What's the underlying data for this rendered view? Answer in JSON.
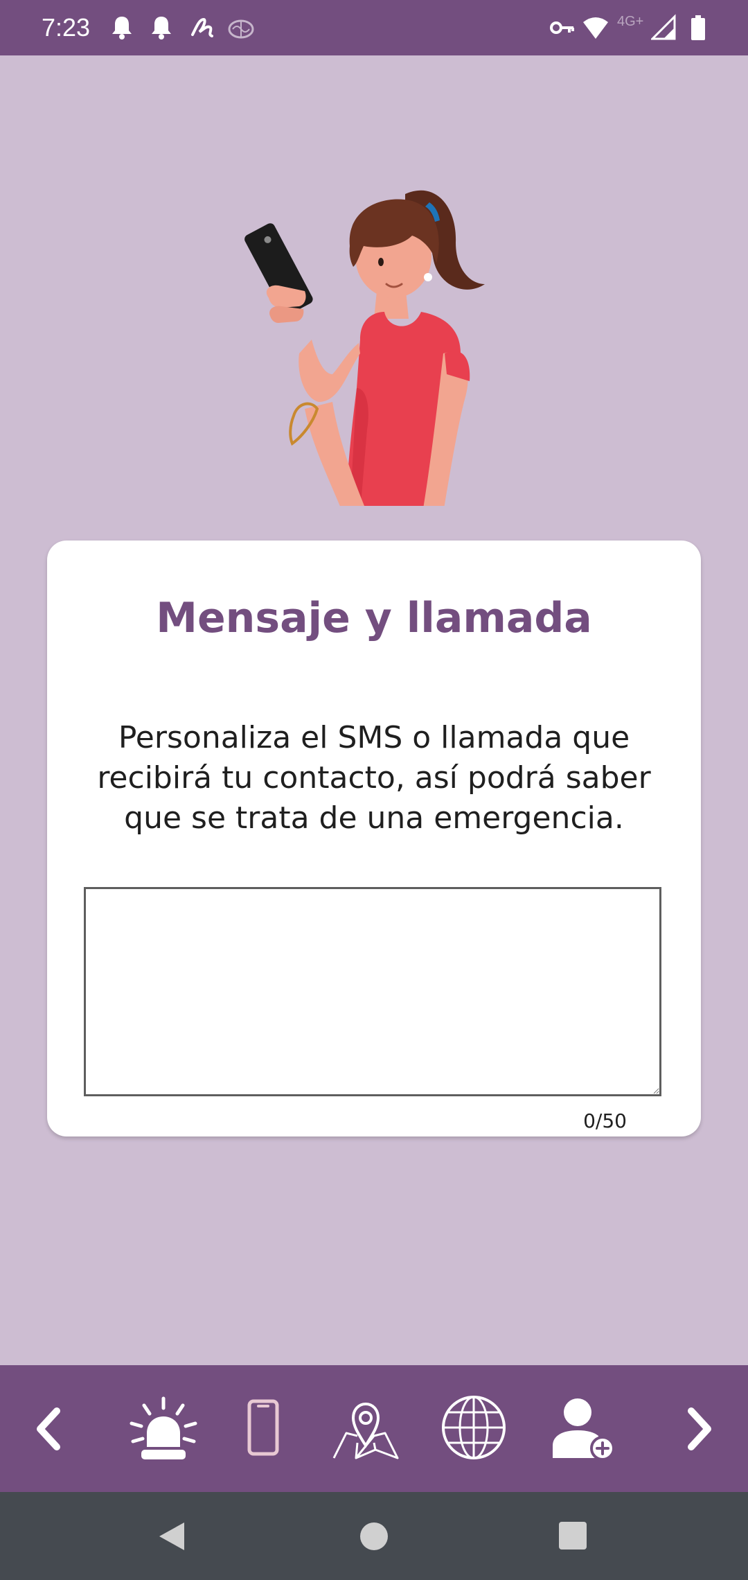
{
  "status_bar": {
    "time": "7:23",
    "network": "4G+",
    "icons": [
      "bell-icon",
      "bell-icon",
      "signature-icon",
      "brain-icon",
      "vpn-key-icon",
      "wifi-icon",
      "signal-icon",
      "battery-icon"
    ]
  },
  "card": {
    "title": "Mensaje y llamada",
    "description": "Personaliza el SMS o llamada que recibirá tu contacto, así podrá saber que se trata de una emergencia.",
    "message_value": "",
    "counter": "0/50"
  },
  "toolbar": {
    "items": [
      "back-arrow-icon",
      "alarm-siren-icon",
      "smartphone-icon",
      "map-pin-icon",
      "globe-icon",
      "add-contact-icon",
      "forward-arrow-icon"
    ],
    "accent_color": "#734e7f",
    "inactive_color": "#e8c9d3"
  },
  "nav_bar": {
    "buttons": [
      "nav-back-icon",
      "nav-home-icon",
      "nav-recents-icon"
    ]
  },
  "colors": {
    "background": "#cdbdd2",
    "primary": "#734e7f",
    "card": "#ffffff"
  }
}
